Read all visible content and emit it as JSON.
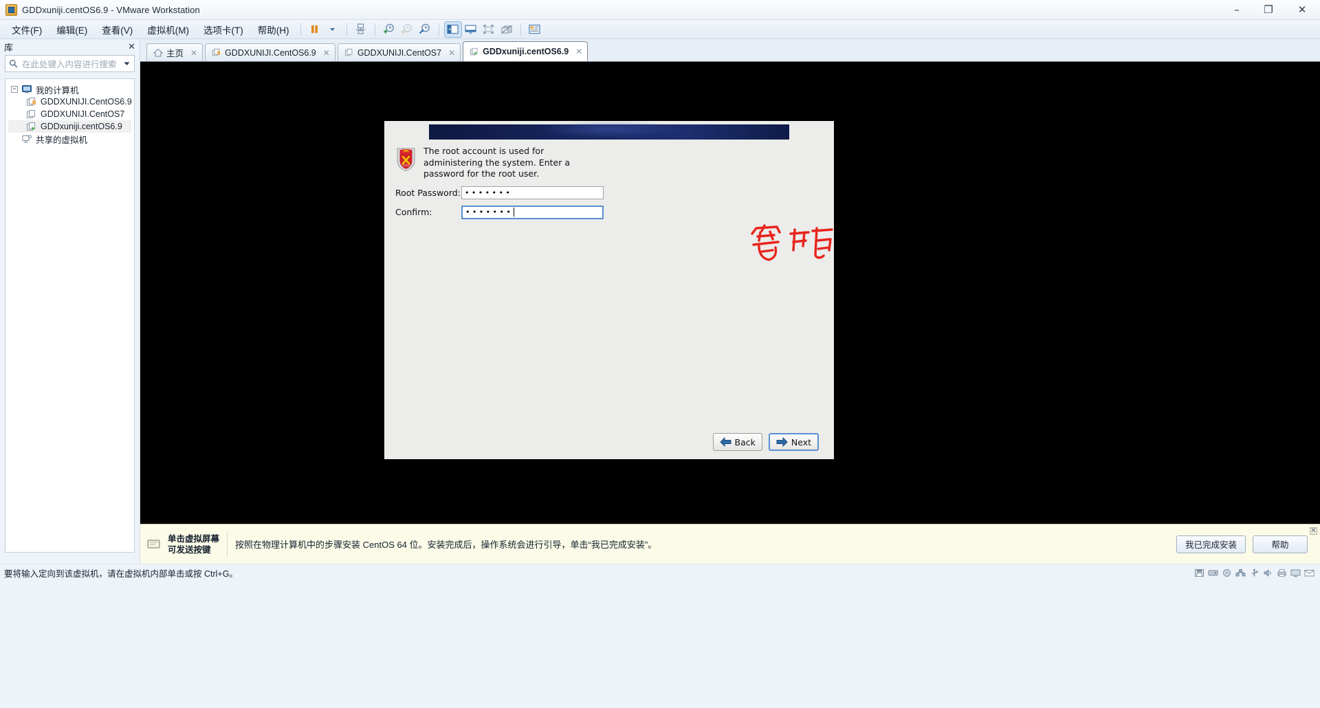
{
  "window": {
    "title": "GDDxuniji.centOS6.9 - VMware Workstation",
    "app_icon": "vmware-icon",
    "minimize": "–",
    "maximize": "❐",
    "close": "✕"
  },
  "menubar": {
    "items": [
      {
        "label": "文件(F)",
        "name": "menu-file"
      },
      {
        "label": "编辑(E)",
        "name": "menu-edit"
      },
      {
        "label": "查看(V)",
        "name": "menu-view"
      },
      {
        "label": "虚拟机(M)",
        "name": "menu-vm"
      },
      {
        "label": "选项卡(T)",
        "name": "menu-tabs"
      },
      {
        "label": "帮助(H)",
        "name": "menu-help"
      }
    ],
    "toolbar": [
      {
        "name": "pause-icon",
        "title": "暂停"
      },
      {
        "name": "dropdown-arrow-icon",
        "title": "下拉"
      },
      {
        "name": "snapshot-manager-icon",
        "title": "快照管理器"
      },
      {
        "name": "take-snapshot-icon",
        "title": "拍摄快照"
      },
      {
        "name": "revert-snapshot-icon",
        "title": "恢复快照"
      },
      {
        "name": "manage-snapshot-icon",
        "title": "管理快照"
      },
      {
        "name": "show-library-icon",
        "title": "显示库",
        "selected": true
      },
      {
        "name": "show-thumbnail-bar-icon",
        "title": "显示缩略图栏"
      },
      {
        "name": "fullscreen-icon",
        "title": "全屏"
      },
      {
        "name": "unity-mode-icon",
        "title": "Unity 模式"
      },
      {
        "name": "console-view-icon",
        "title": "控制台视图"
      }
    ]
  },
  "sidebar": {
    "header": "库",
    "close": "✕",
    "search_placeholder": "在此处键入内容进行搜索",
    "search_icon": "search-icon",
    "dropdown_icon": "chevron-down-icon",
    "tree": [
      {
        "label": "我的计算机",
        "level": 0,
        "icon": "my-computer-icon",
        "expander": "−",
        "selected": false
      },
      {
        "label": "GDDXUNIJI.CentOS6.9",
        "level": 1,
        "icon": "vm-suspended-icon",
        "selected": false
      },
      {
        "label": "GDDXUNIJI.CentOS7",
        "level": 1,
        "icon": "vm-powered-off-icon",
        "selected": false
      },
      {
        "label": "GDDxuniji.centOS6.9",
        "level": 1,
        "icon": "vm-running-icon",
        "selected": true
      },
      {
        "label": "共享的虚拟机",
        "level": 0,
        "icon": "shared-vms-icon",
        "expander": "",
        "selected": false
      }
    ]
  },
  "tabs": [
    {
      "label": "主页",
      "icon": "home-icon",
      "close": "✕",
      "active": false
    },
    {
      "label": "GDDXUNIJI.CentOS6.9",
      "icon": "vm-suspended-icon",
      "close": "✕",
      "active": false
    },
    {
      "label": "GDDXUNIJI.CentOS7",
      "icon": "vm-powered-off-icon",
      "close": "✕",
      "active": false
    },
    {
      "label": "GDDxuniji.centOS6.9",
      "icon": "vm-running-icon",
      "close": "✕",
      "active": true
    }
  ],
  "installer": {
    "logo": "centos-shield-icon",
    "description": "The root account is used for administering the system.  Enter a password for the root user.",
    "fields": [
      {
        "label": "Root Password:",
        "value": "•••••••",
        "focused": false,
        "name": "root-password-input"
      },
      {
        "label": "Confirm:",
        "value": "•••••••",
        "focused": true,
        "name": "confirm-password-input"
      }
    ],
    "back_label": "Back",
    "next_label": "Next",
    "back_icon": "arrow-left-icon",
    "next_icon": "arrow-right-icon"
  },
  "annotation": {
    "text": "密码",
    "color": "#e8241c"
  },
  "notify": {
    "icon": "vm-screen-icon",
    "left_line1": "单击虚拟屏幕",
    "left_line2": "可发送按键",
    "message": "按照在物理计算机中的步骤安装 CentOS 64 位。安装完成后，操作系统会进行引导，单击“我已完成安装”。",
    "buttons": [
      {
        "label": "我已完成安装",
        "name": "finished-install-button"
      },
      {
        "label": "帮助",
        "name": "help-button"
      }
    ],
    "close": "✕"
  },
  "statusbar": {
    "message": "要将输入定向到该虚拟机，请在虚拟机内部单击或按 Ctrl+G。",
    "tray": [
      {
        "name": "floppy-icon"
      },
      {
        "name": "harddisk-icon"
      },
      {
        "name": "cdrom-icon"
      },
      {
        "name": "network-icon"
      },
      {
        "name": "usb-icon"
      },
      {
        "name": "sound-icon"
      },
      {
        "name": "printer-icon"
      },
      {
        "name": "display-icon"
      },
      {
        "name": "message-icon"
      }
    ]
  },
  "colors": {
    "accent": "#2b6ca3",
    "annotation_red": "#e8241c",
    "console_bg": "#000000",
    "installer_bg": "#ececea",
    "notify_bg": "#fbfbe8"
  }
}
